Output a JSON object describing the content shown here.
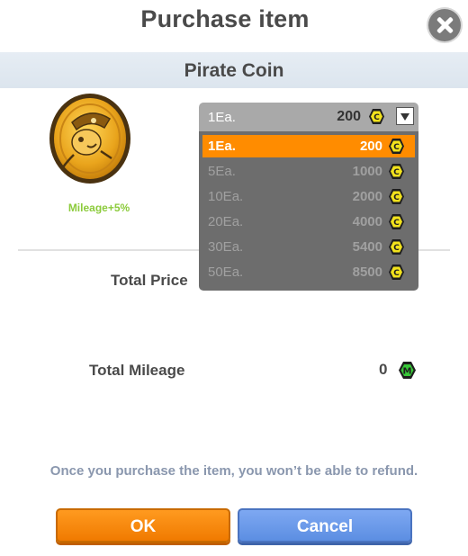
{
  "dialog": {
    "title": "Purchase item",
    "item_name": "Pirate Coin",
    "mileage_bonus": "Mileage+5%",
    "total_price_label": "Total Price",
    "total_mileage_label": "Total Mileage",
    "total_mileage_value": "0",
    "mileage_icon_letter": "M",
    "notice": "Once you purchase the item, you won’t be able to refund.",
    "ok_label": "OK",
    "cancel_label": "Cancel"
  },
  "quantity_select": {
    "selected_qty": "1Ea.",
    "selected_price": "200",
    "currency_icon_letter": "C",
    "options": [
      {
        "qty": "1Ea.",
        "price": "200",
        "selected": true
      },
      {
        "qty": "5Ea.",
        "price": "1000",
        "selected": false
      },
      {
        "qty": "10Ea.",
        "price": "2000",
        "selected": false
      },
      {
        "qty": "20Ea.",
        "price": "4000",
        "selected": false
      },
      {
        "qty": "30Ea.",
        "price": "5400",
        "selected": false
      },
      {
        "qty": "50Ea.",
        "price": "8500",
        "selected": false
      }
    ]
  },
  "icons": {
    "close": "close-icon",
    "coin_currency": "coin-currency-icon",
    "mileage": "mileage-icon",
    "dropdown": "chevron-down-icon",
    "item_image": "pirate-coin-icon"
  },
  "colors": {
    "accent_orange": "#ff8c00",
    "button_blue": "#6b9ae8",
    "mileage_green": "#8ccb3c",
    "notice_gray": "#8a97ae"
  }
}
